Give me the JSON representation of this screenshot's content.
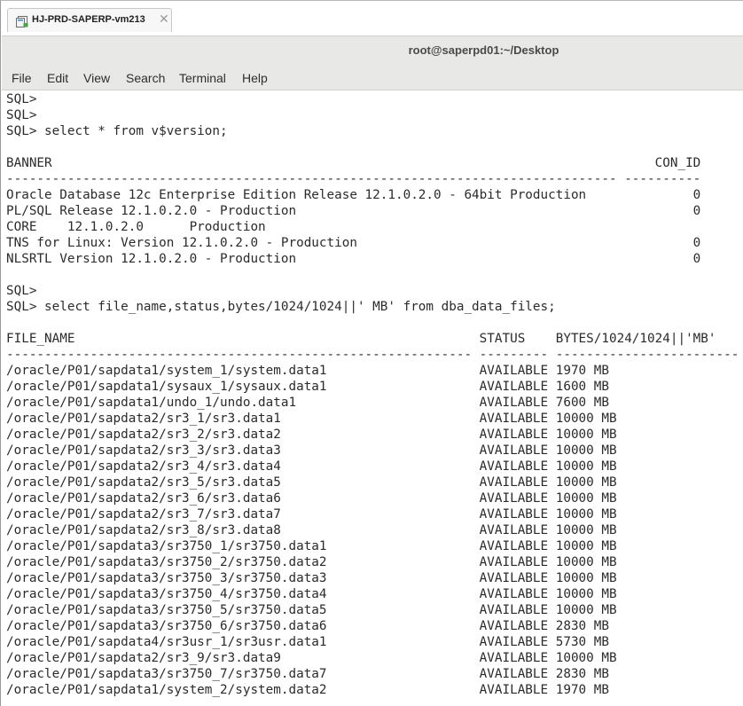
{
  "tab": {
    "label": "HJ-PRD-SAPERP-vm213",
    "close": "✕"
  },
  "window": {
    "title": "root@saperpd01:~/Desktop"
  },
  "menu": [
    "File",
    "Edit",
    "View",
    "Search",
    "Terminal",
    "Help"
  ],
  "terminal_lines": [
    "SQL>",
    "SQL>",
    "SQL> select * from v$version;",
    "",
    "BANNER                                                                               CON_ID",
    "-------------------------------------------------------------------------------- ----------",
    "Oracle Database 12c Enterprise Edition Release 12.1.0.2.0 - 64bit Production              0",
    "PL/SQL Release 12.1.0.2.0 - Production                                                    0",
    "CORE    12.1.0.2.0      Production",
    "TNS for Linux: Version 12.1.0.2.0 - Production                                            0",
    "NLSRTL Version 12.1.0.2.0 - Production                                                    0",
    "",
    "SQL>",
    "SQL> select file_name,status,bytes/1024/1024||' MB' from dba_data_files;",
    "",
    "FILE_NAME                                                     STATUS    BYTES/1024/1024||'MB'",
    "------------------------------------------------------------- --------- ------------------------",
    "/oracle/P01/sapdata1/system_1/system.data1                    AVAILABLE 1970 MB",
    "/oracle/P01/sapdata1/sysaux_1/sysaux.data1                    AVAILABLE 1600 MB",
    "/oracle/P01/sapdata1/undo_1/undo.data1                        AVAILABLE 7600 MB",
    "/oracle/P01/sapdata2/sr3_1/sr3.data1                          AVAILABLE 10000 MB",
    "/oracle/P01/sapdata2/sr3_2/sr3.data2                          AVAILABLE 10000 MB",
    "/oracle/P01/sapdata2/sr3_3/sr3.data3                          AVAILABLE 10000 MB",
    "/oracle/P01/sapdata2/sr3_4/sr3.data4                          AVAILABLE 10000 MB",
    "/oracle/P01/sapdata2/sr3_5/sr3.data5                          AVAILABLE 10000 MB",
    "/oracle/P01/sapdata2/sr3_6/sr3.data6                          AVAILABLE 10000 MB",
    "/oracle/P01/sapdata2/sr3_7/sr3.data7                          AVAILABLE 10000 MB",
    "/oracle/P01/sapdata2/sr3_8/sr3.data8                          AVAILABLE 10000 MB",
    "/oracle/P01/sapdata3/sr3750_1/sr3750.data1                    AVAILABLE 10000 MB",
    "/oracle/P01/sapdata3/sr3750_2/sr3750.data2                    AVAILABLE 10000 MB",
    "/oracle/P01/sapdata3/sr3750_3/sr3750.data3                    AVAILABLE 10000 MB",
    "/oracle/P01/sapdata3/sr3750_4/sr3750.data4                    AVAILABLE 10000 MB",
    "/oracle/P01/sapdata3/sr3750_5/sr3750.data5                    AVAILABLE 10000 MB",
    "/oracle/P01/sapdata3/sr3750_6/sr3750.data6                    AVAILABLE 2830 MB",
    "/oracle/P01/sapdata4/sr3usr_1/sr3usr.data1                    AVAILABLE 5730 MB",
    "/oracle/P01/sapdata2/sr3_9/sr3.data9                          AVAILABLE 10000 MB",
    "/oracle/P01/sapdata3/sr3750_7/sr3750.data7                    AVAILABLE 2830 MB",
    "/oracle/P01/sapdata1/system_2/system.data2                    AVAILABLE 1970 MB"
  ]
}
